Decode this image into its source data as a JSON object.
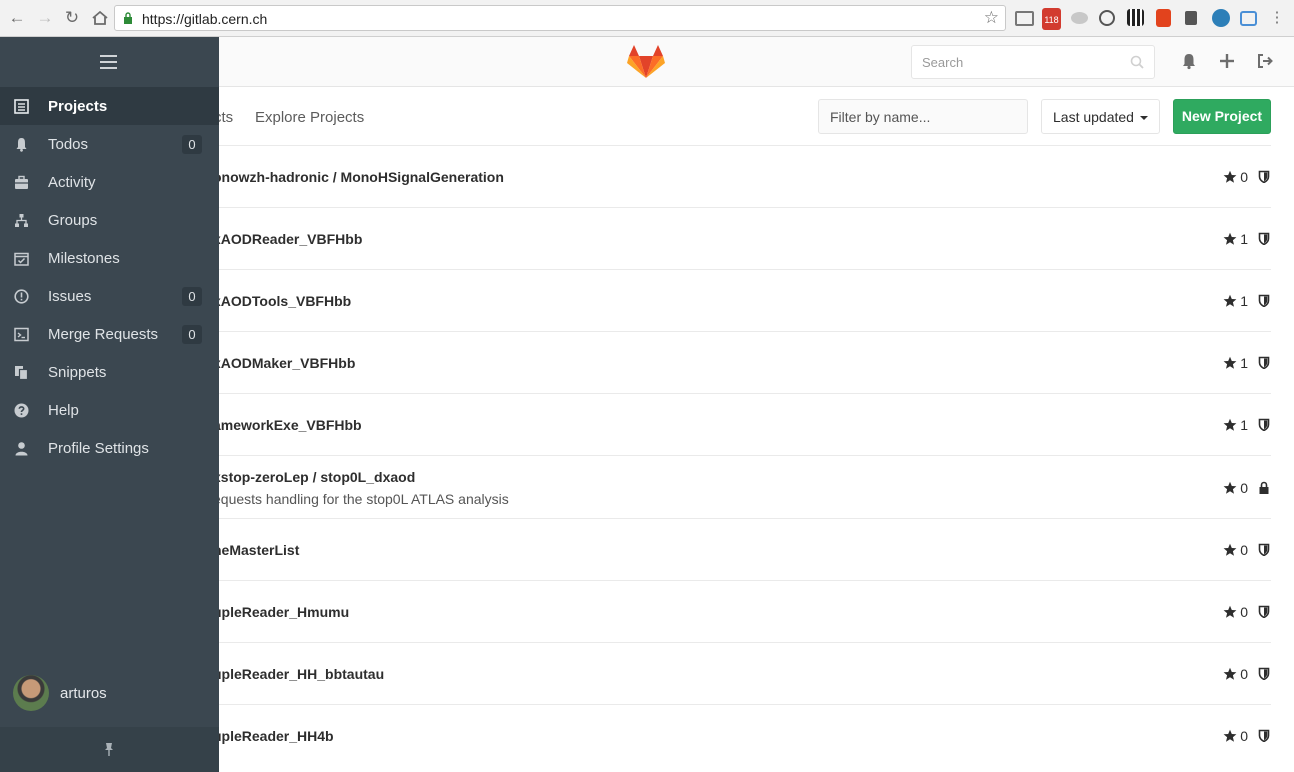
{
  "browser": {
    "url": "https://gitlab.cern.ch",
    "extension_badge": "118"
  },
  "sidebar": {
    "items": [
      {
        "label": "Projects",
        "icon": "projects-icon",
        "count": null,
        "active": true
      },
      {
        "label": "Todos",
        "icon": "bell-icon",
        "count": "0"
      },
      {
        "label": "Activity",
        "icon": "dashboard-icon",
        "count": null
      },
      {
        "label": "Groups",
        "icon": "sitemap-icon",
        "count": null
      },
      {
        "label": "Milestones",
        "icon": "calendar-check-icon",
        "count": null
      },
      {
        "label": "Issues",
        "icon": "exclamation-circle-icon",
        "count": "0"
      },
      {
        "label": "Merge Requests",
        "icon": "terminal-icon",
        "count": "0"
      },
      {
        "label": "Snippets",
        "icon": "copy-icon",
        "count": null
      },
      {
        "label": "Help",
        "icon": "question-circle-icon",
        "count": null
      },
      {
        "label": "Profile Settings",
        "icon": "user-icon",
        "count": null
      }
    ],
    "username": "arturos"
  },
  "header": {
    "search_placeholder": "Search"
  },
  "toolbar": {
    "tabs": [
      "cts",
      "Explore Projects"
    ],
    "filter_placeholder": "Filter by name...",
    "sort_label": "Last updated",
    "new_project_label": "New Project"
  },
  "projects": [
    {
      "name": "onowzh-hadronic / MonoHSignalGeneration",
      "desc": "",
      "stars": "0",
      "visibility": "internal"
    },
    {
      "name": "xAODReader_VBFHbb",
      "desc": "",
      "stars": "1",
      "visibility": "internal"
    },
    {
      "name": "xAODTools_VBFHbb",
      "desc": "",
      "stars": "1",
      "visibility": "internal"
    },
    {
      "name": "xAODMaker_VBFHbb",
      "desc": "",
      "stars": "1",
      "visibility": "internal"
    },
    {
      "name": "ameworkExe_VBFHbb",
      "desc": "",
      "stars": "1",
      "visibility": "internal"
    },
    {
      "name": "xstop-zeroLep / stop0L_dxaod",
      "desc": "equests handling for the stop0L ATLAS analysis",
      "stars": "0",
      "visibility": "private"
    },
    {
      "name": "neMasterList",
      "desc": "",
      "stars": "0",
      "visibility": "internal"
    },
    {
      "name": "upleReader_Hmumu",
      "desc": "",
      "stars": "0",
      "visibility": "internal"
    },
    {
      "name": "upleReader_HH_bbtautau",
      "desc": "",
      "stars": "0",
      "visibility": "internal"
    },
    {
      "name": "upleReader_HH4b",
      "desc": "",
      "stars": "0",
      "visibility": "internal"
    }
  ],
  "colors": {
    "sidebar_bg": "#3b4750",
    "sidebar_active": "#2f3a42",
    "primary_green": "#2faa60",
    "logo_orange": "#fc6d26"
  }
}
